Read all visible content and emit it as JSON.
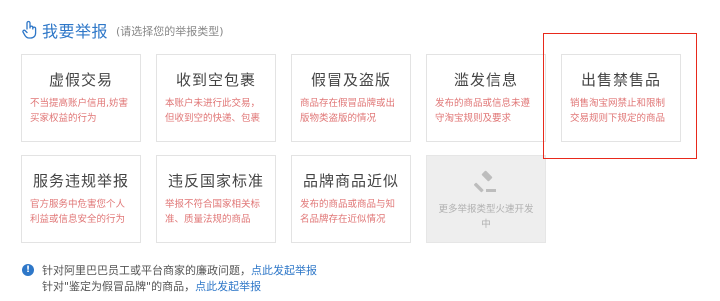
{
  "header": {
    "title": "我要举报",
    "subtitle": "(请选择您的举报类型)"
  },
  "cards": [
    {
      "title": "虚假交易",
      "desc": "不当提高账户信用,妨害买家权益的行为"
    },
    {
      "title": "收到空包裹",
      "desc": "本账户未进行此交易，但收到空的快递、包裹"
    },
    {
      "title": "假冒及盗版",
      "desc": "商品存在假冒品牌或出版物类盗版的情况"
    },
    {
      "title": "滥发信息",
      "desc": "发布的商品或信息未遵守淘宝规则及要求"
    },
    {
      "title": "出售禁售品",
      "desc": "销售淘宝网禁止和限制交易规则下规定的商品"
    },
    {
      "title": "服务违规举报",
      "desc": "官方服务中危害您个人利益或信息安全的行为"
    },
    {
      "title": "违反国家标准",
      "desc": "举报不符合国家相关标准、质量法规的商品"
    },
    {
      "title": "品牌商品近似",
      "desc": "发布的商品或商品与知名品牌存在近似情况"
    }
  ],
  "disabled_card": {
    "desc": "更多举报类型火速开发中"
  },
  "notice": {
    "line1_text": "针对阿里巴巴员工或平台商家的廉政问题，",
    "line1_link": "点此发起举报",
    "line2_text": "针对\"鉴定为假冒品牌\"的商品，",
    "line2_link": "点此发起举报"
  },
  "colors": {
    "accent_blue": "#2e77c8",
    "desc_red": "#e07676",
    "highlight_red": "#e8291b"
  }
}
